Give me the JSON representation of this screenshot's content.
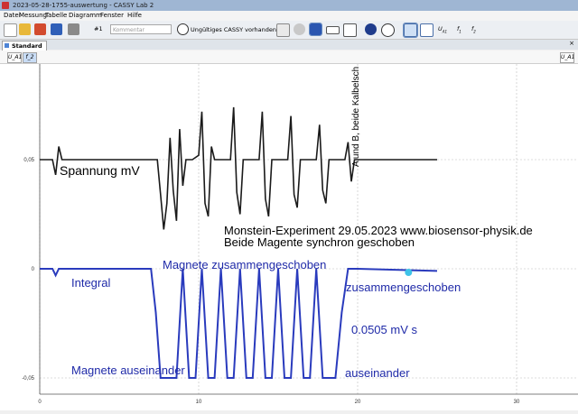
{
  "window": {
    "title": "2023-05-28-1755-auswertung - CASSY Lab 2"
  },
  "menu": [
    "Datei",
    "Messung",
    "Tabelle",
    "Diagramm",
    "Fenster",
    "Hilfe"
  ],
  "toolbar": {
    "comment_placeholder": "Kommentar",
    "cassy_status": "Ungültiges CASSY vorhanden",
    "numbering": "#1"
  },
  "tabs": [
    {
      "label": "Standard",
      "active": true
    }
  ],
  "axis_buttons": {
    "left_1": "U_A1",
    "left_2": "f_2",
    "right_1": "U_A1"
  },
  "colors": {
    "curve1": "#1a1a1a",
    "curve2": "#2a3bbd",
    "annotation_blue": "#1f2aa8",
    "marker": "#3ec3e8"
  },
  "chart_data": {
    "type": "line",
    "x_ticks": [
      "0",
      "10",
      "20",
      "30"
    ],
    "xlim": [
      0,
      33
    ],
    "y_ticks": [
      "0,05",
      "0",
      "-0,05"
    ],
    "series": [
      {
        "color": "#1a1a1a",
        "x": [
          0,
          0.8,
          1,
          1.2,
          1.4,
          1.6,
          2,
          7.4,
          7.6,
          7.8,
          8.0,
          8.2,
          8.4,
          8.6,
          8.8,
          9.0,
          9.2,
          9.6,
          10.0,
          10.2,
          10.4,
          10.6,
          10.8,
          11.0,
          11.6,
          12.0,
          12.2,
          12.4,
          12.6,
          12.8,
          13.4,
          13.8,
          14.0,
          14.2,
          14.4,
          14.6,
          15.2,
          15.6,
          15.8,
          16.0,
          16.2,
          16.4,
          17.0,
          17.4,
          17.6,
          17.8,
          18.0,
          18.2,
          18.8,
          19.2,
          19.4,
          19.6,
          19.8,
          20.0,
          25.0
        ],
        "y": [
          0.05,
          0.05,
          0.043,
          0.056,
          0.05,
          0.05,
          0.05,
          0.05,
          0.034,
          0.018,
          0.03,
          0.06,
          0.036,
          0.022,
          0.064,
          0.038,
          0.05,
          0.05,
          0.052,
          0.072,
          0.03,
          0.024,
          0.056,
          0.05,
          0.05,
          0.05,
          0.074,
          0.035,
          0.025,
          0.05,
          0.05,
          0.05,
          0.072,
          0.032,
          0.024,
          0.05,
          0.05,
          0.05,
          0.07,
          0.034,
          0.028,
          0.05,
          0.05,
          0.05,
          0.066,
          0.036,
          0.03,
          0.05,
          0.05,
          0.05,
          0.058,
          0.04,
          0.05,
          0.05,
          0.05
        ]
      },
      {
        "color": "#2a3bbd",
        "x": [
          0,
          0.8,
          1.0,
          1.2,
          7.0,
          7.3,
          7.6,
          8.2,
          8.6,
          9.0,
          9.4,
          9.8,
          10.2,
          10.6,
          11.0,
          11.4,
          11.8,
          12.2,
          12.6,
          13.0,
          13.4,
          13.8,
          14.2,
          14.6,
          15.0,
          15.4,
          15.8,
          16.2,
          16.6,
          17.0,
          17.4,
          17.8,
          18.2,
          18.6,
          19.0,
          19.4,
          20.0,
          25.0
        ],
        "y": [
          0,
          0,
          -0.003,
          0,
          0,
          -0.02,
          -0.05,
          -0.05,
          -0.05,
          0,
          -0.05,
          -0.05,
          0,
          -0.05,
          -0.05,
          0,
          -0.05,
          -0.05,
          0,
          -0.05,
          -0.05,
          0,
          -0.05,
          -0.05,
          0,
          -0.05,
          -0.05,
          0,
          -0.05,
          -0.05,
          0,
          -0.05,
          -0.05,
          -0.05,
          -0.02,
          0,
          0,
          -0.001
        ]
      }
    ],
    "marker": {
      "x": 23.2,
      "y": 0
    },
    "annotations": {
      "label_spannung": "Spannung   mV",
      "label_vertical": "A und B, beide Kalbelsch",
      "title_line1": "Monstein-Experiment 29.05.2023 www.biosensor-physik.de",
      "title_line2": "Beide Magente synchron geschoben",
      "label_zusammen_top": "Magnete zusammengeschoben",
      "label_integral": "Integral",
      "label_zusammen_right": "zusammengeschoben",
      "label_value": "0.0505 mV s",
      "label_auseinander_left": "Magnete auseinander",
      "label_auseinander_right": "auseinander"
    }
  }
}
